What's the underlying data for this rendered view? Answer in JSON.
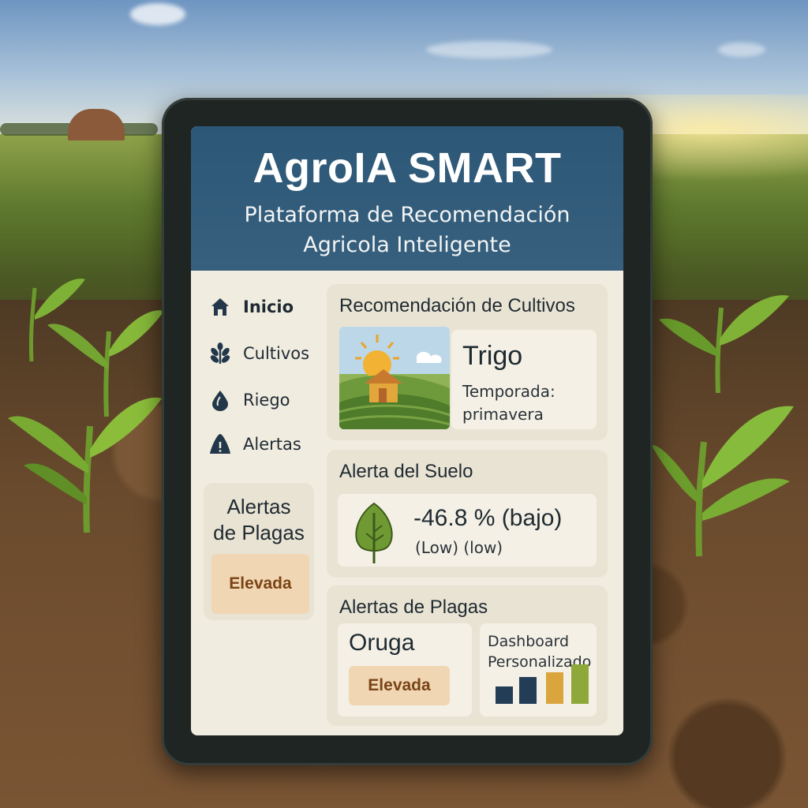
{
  "header": {
    "title": "AgroIA SMART",
    "subtitle_line1": "Plataforma de Recomendación",
    "subtitle_line2": "Agricola Inteligente"
  },
  "sidebar": {
    "items": [
      {
        "label": "Inicio",
        "icon": "home-icon"
      },
      {
        "label": "Cultivos",
        "icon": "leaf-sprig-icon"
      },
      {
        "label": "Riego",
        "icon": "water-drop-icon"
      },
      {
        "label": "Alertas",
        "icon": "alert-triangle-icon"
      }
    ],
    "pest_card": {
      "title_line1": "Alertas",
      "title_line2": "de Plagas",
      "level": "Elevada"
    }
  },
  "crop_card": {
    "title": "Recomendación de Cultivos",
    "crop": "Trigo",
    "season_line1": "Temporada:",
    "season_line2": "primavera"
  },
  "soil_card": {
    "title": "Alerta del Suelo",
    "value": "-46.8 % (bajo)",
    "detail": "(Low) (low)"
  },
  "pest_card": {
    "title": "Alertas de Plagas",
    "pest": "Oruga",
    "level": "Elevada",
    "dashboard_line1": "Dashboard",
    "dashboard_line2": "Personalizado"
  },
  "colors": {
    "header": "#2d5777",
    "screen": "#f1ece0",
    "card": "#e9e3d4",
    "badge_bg": "#f0d6b3",
    "badge_text": "#7a4416"
  }
}
